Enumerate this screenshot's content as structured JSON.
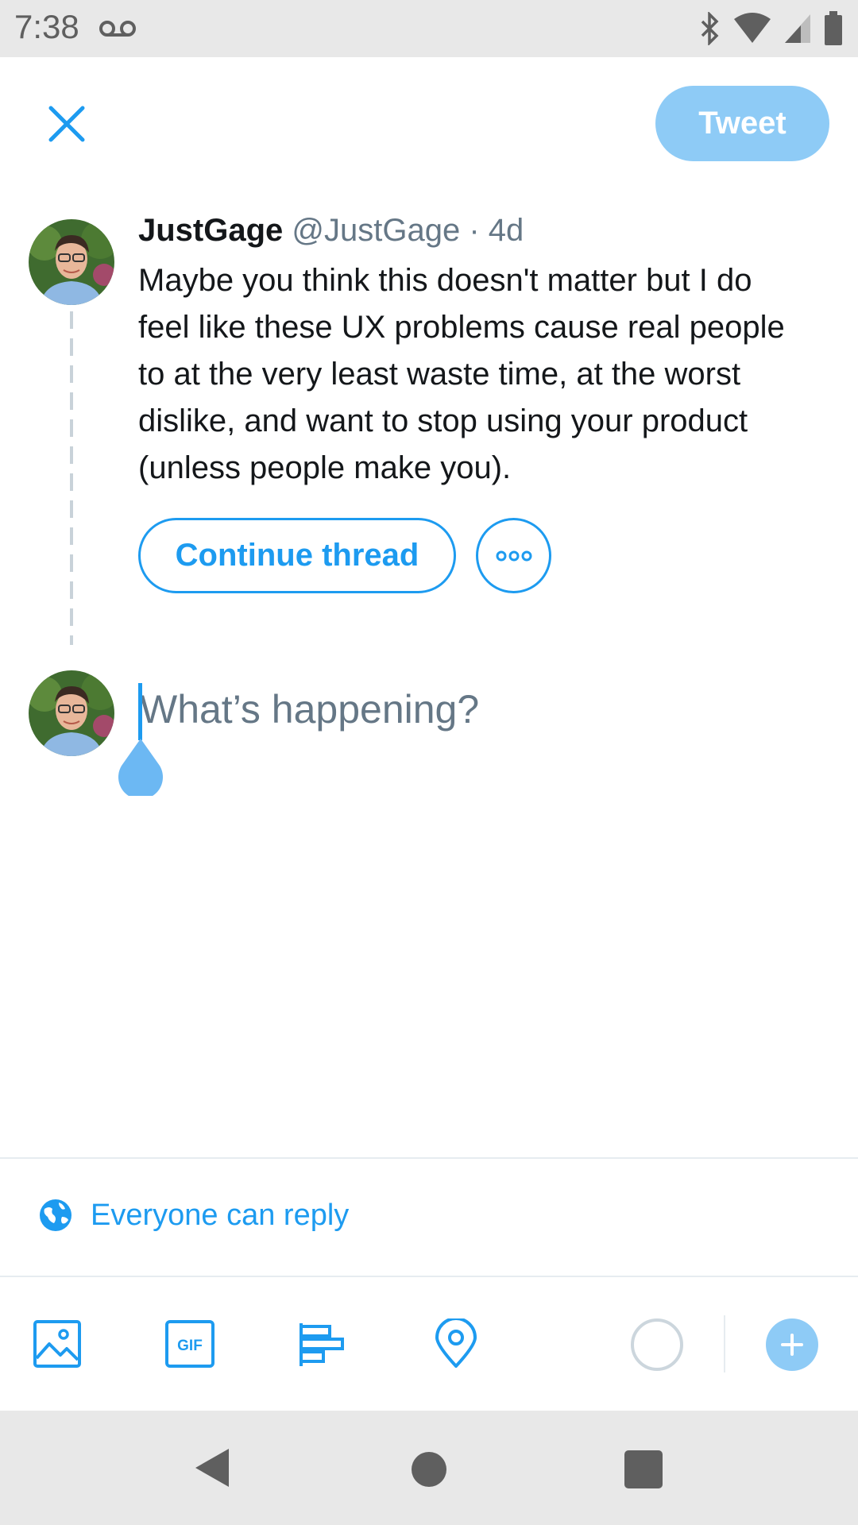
{
  "status_bar": {
    "time": "7:38",
    "icons": [
      "voicemail-icon",
      "bluetooth-icon",
      "wifi-icon",
      "cell-signal-icon",
      "battery-icon"
    ]
  },
  "header": {
    "close_icon": "close-icon",
    "tweet_label": "Tweet"
  },
  "original_tweet": {
    "name": "JustGage",
    "handle": "@JustGage",
    "separator": " · ",
    "age": "4d",
    "text": "Maybe you think this doesn't matter but I do feel like these UX problems cause real people to at the very least waste time, at the worst dislike, and want to stop using your product (unless people make you).",
    "continue_label": "Continue thread",
    "more_icon": "more-horizontal-icon"
  },
  "compose": {
    "placeholder": "What’s happening?"
  },
  "reply_setting": {
    "icon": "globe-icon",
    "label": "Everyone can reply"
  },
  "toolbar": {
    "icons": [
      "image-icon",
      "gif-icon",
      "poll-icon",
      "location-icon"
    ],
    "add_icon": "plus-icon"
  },
  "nav_bar": {
    "icons": [
      "back-icon",
      "home-icon",
      "recent-apps-icon"
    ]
  },
  "colors": {
    "accent": "#1d9bf0",
    "tweet_button_disabled": "#8ecbf6",
    "secondary_text": "#657786",
    "system_bar": "#e8e8e8"
  }
}
